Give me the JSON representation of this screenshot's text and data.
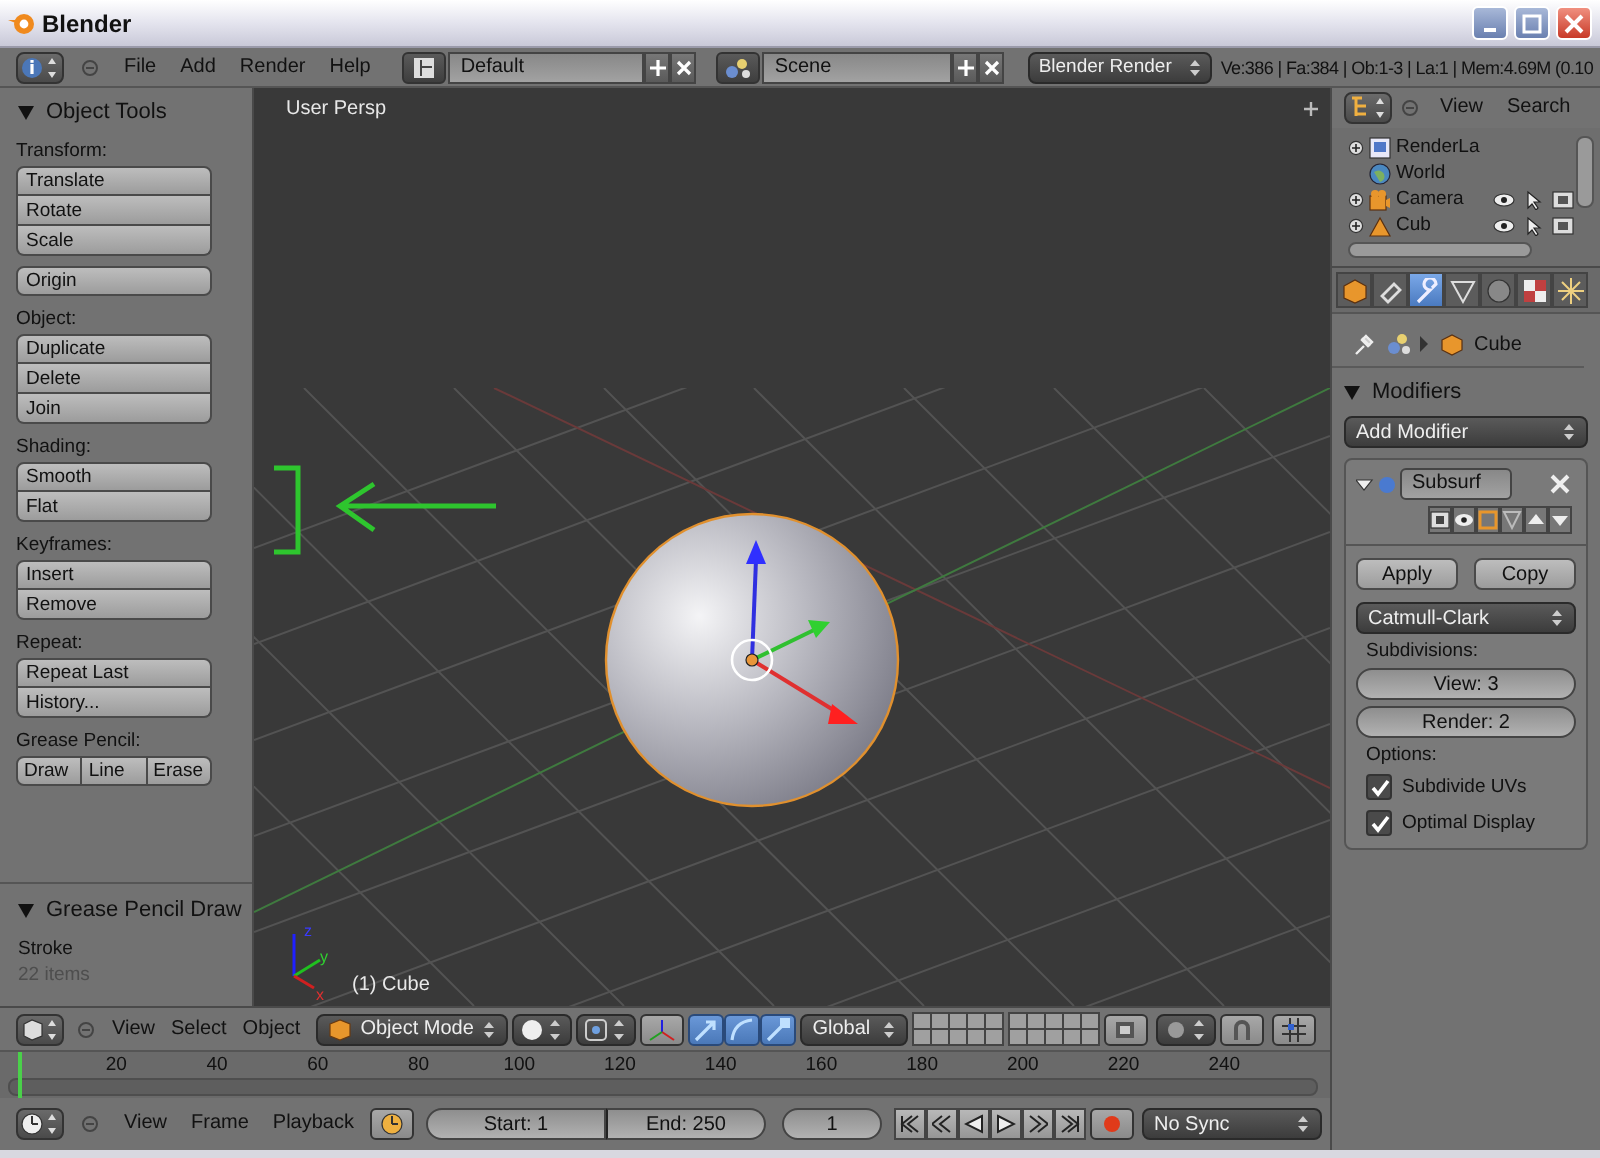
{
  "window": {
    "title": "Blender"
  },
  "info_header": {
    "menus": [
      "File",
      "Add",
      "Render",
      "Help"
    ],
    "layout": "Default",
    "scene": "Scene",
    "engine": "Blender Render",
    "stats": "Ve:386 | Fa:384 | Ob:1-3 | La:1 | Mem:4.69M (0.10"
  },
  "tool_shelf": {
    "object_tools": {
      "title": "Object Tools",
      "expanded": true,
      "groups": [
        {
          "label": "Transform:",
          "kind": "column",
          "buttons": [
            "Translate",
            "Rotate",
            "Scale"
          ]
        },
        {
          "kind": "column",
          "buttons": [
            "Origin"
          ]
        },
        {
          "label": "Object:",
          "kind": "column",
          "buttons": [
            "Duplicate",
            "Delete",
            "Join"
          ]
        },
        {
          "label": "Shading:",
          "kind": "column",
          "buttons": [
            "Smooth",
            "Flat"
          ]
        },
        {
          "label": "Keyframes:",
          "kind": "column",
          "buttons": [
            "Insert",
            "Remove"
          ]
        },
        {
          "label": "Repeat:",
          "kind": "column",
          "buttons": [
            "Repeat Last",
            "History..."
          ]
        },
        {
          "label": "Grease Pencil:",
          "kind": "row",
          "buttons": [
            "Draw",
            "Line",
            "Erase"
          ]
        }
      ]
    },
    "grease_pencil_draw": {
      "title": "Grease Pencil Draw",
      "expanded": true,
      "label": "Stroke",
      "note": "22 items"
    }
  },
  "viewport": {
    "view_label": "User Persp",
    "object_label": "(1) Cube",
    "axis_labels": [
      "z",
      "y",
      "x"
    ]
  },
  "view3d_header": {
    "menus": [
      "View",
      "Select",
      "Object"
    ],
    "mode": "Object Mode",
    "orientation": "Global"
  },
  "timeline": {
    "ticks": [
      "20",
      "40",
      "60",
      "80",
      "100",
      "120",
      "140",
      "160",
      "180",
      "200",
      "220",
      "240"
    ],
    "menus": [
      "View",
      "Frame",
      "Playback"
    ],
    "start": "Start: 1",
    "end": "End: 250",
    "current": "1",
    "sync": "No Sync"
  },
  "outliner": {
    "menus": [
      "View",
      "Search"
    ],
    "items": [
      {
        "name": "RenderLa",
        "kind": "renderlayer",
        "expandable": true
      },
      {
        "name": "World",
        "kind": "world",
        "expandable": false
      },
      {
        "name": "Camera",
        "kind": "camera",
        "expandable": true
      },
      {
        "name": "Cub",
        "kind": "mesh",
        "expandable": true
      }
    ]
  },
  "properties": {
    "tabs": [
      {
        "kind": "object",
        "selected": false
      },
      {
        "kind": "constraints",
        "selected": false
      },
      {
        "kind": "modifiers",
        "selected": true
      },
      {
        "kind": "data",
        "selected": false
      },
      {
        "kind": "material",
        "selected": false
      },
      {
        "kind": "texture",
        "selected": false
      },
      {
        "kind": "particles",
        "selected": false
      }
    ],
    "breadcrumb": "Cube",
    "modifiers_panel": {
      "title": "Modifiers",
      "expanded": true,
      "add_modifier": "Add Modifier",
      "modifier": {
        "name": "Subsurf",
        "expanded": true,
        "apply": "Apply",
        "copy": "Copy",
        "type": "Catmull-Clark",
        "subdivisions_label": "Subdivisions:",
        "view": "View: 3",
        "render": "Render: 2",
        "options_label": "Options:",
        "options": [
          {
            "label": "Subdivide UVs",
            "checked": true
          },
          {
            "label": "Optimal Display",
            "checked": true
          }
        ]
      }
    }
  }
}
